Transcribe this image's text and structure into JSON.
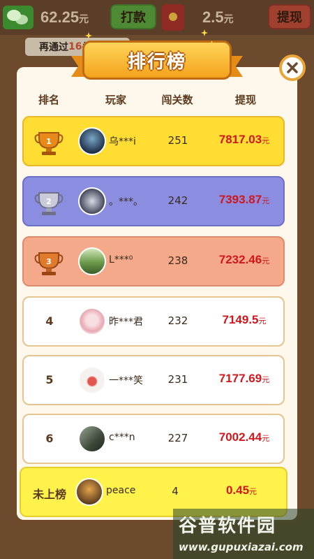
{
  "topbar": {
    "balance_value": "62.25",
    "balance_unit": "元",
    "withdraw_button": "打款",
    "coin_value": "2.5",
    "coin_unit": "元",
    "cashout_button": "提现",
    "progress_pre": "再通过",
    "progress_num": "16",
    "progress_post": "关 多"
  },
  "panel": {
    "title": "排行榜",
    "headers": {
      "rank": "排名",
      "player": "玩家",
      "levels": "闯关数",
      "cash": "提现"
    }
  },
  "rows": [
    {
      "rank": "1",
      "name": "乌***i",
      "levels": "251",
      "money": "7817.03",
      "unit": "元"
    },
    {
      "rank": "2",
      "name": "。***。",
      "levels": "242",
      "money": "7393.87",
      "unit": "元"
    },
    {
      "rank": "3",
      "name": "L***⁰",
      "levels": "238",
      "money": "7232.46",
      "unit": "元"
    },
    {
      "rank": "4",
      "name": "昨***君",
      "levels": "232",
      "money": "7149.5",
      "unit": "元"
    },
    {
      "rank": "5",
      "name": "一***笑",
      "levels": "231",
      "money": "7177.69",
      "unit": "元"
    },
    {
      "rank": "6",
      "name": "c***n",
      "levels": "227",
      "money": "7002.44",
      "unit": "元"
    }
  ],
  "me": {
    "rank": "未上榜",
    "name": "peace",
    "levels": "4",
    "money": "0.45",
    "unit": "元"
  },
  "watermark": {
    "title": "谷普软件园",
    "url": "www.gupuxiazai.com"
  },
  "colors": {
    "gold": "#ffdd33",
    "silver": "#8a8de0",
    "bronze": "#f4a98a",
    "money": "#d1171c"
  }
}
